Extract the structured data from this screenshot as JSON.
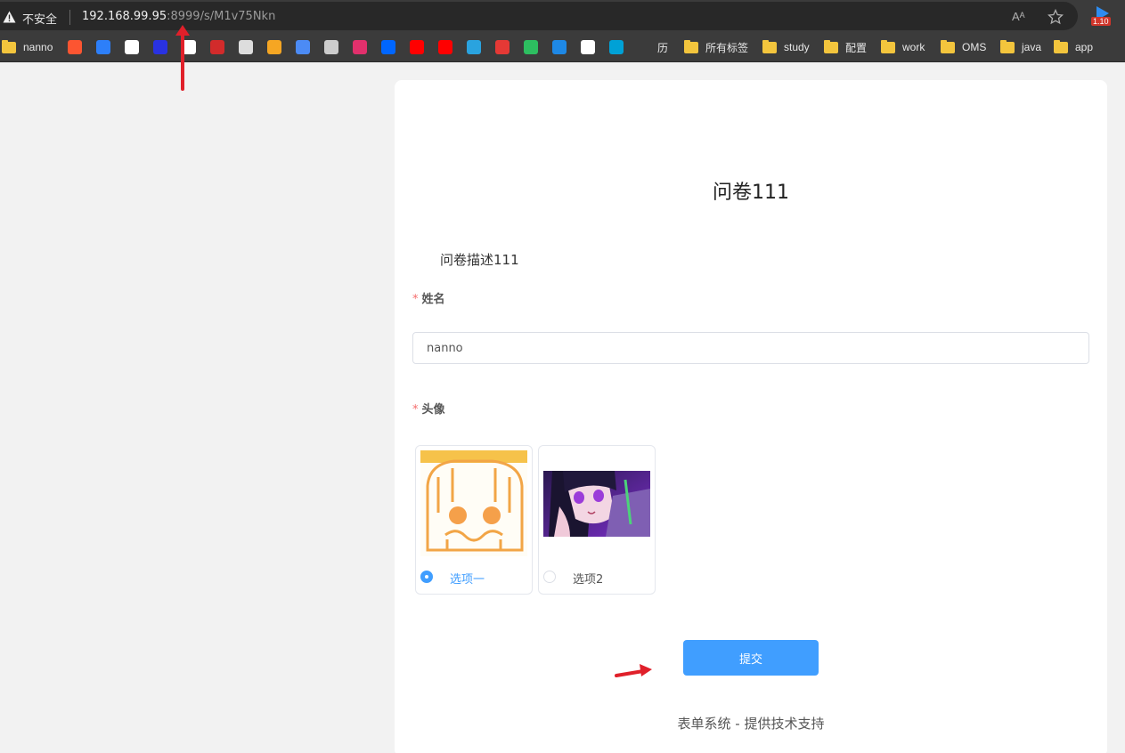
{
  "browser": {
    "insecure_label": "不安全",
    "url_host": "192.168.99.95",
    "url_path": ":8999/s/M1v75Nkn",
    "read_aloud_label": "Aᴬ",
    "extension_badge": "1.10",
    "bookmarks": [
      {
        "type": "folder",
        "label": "nanno"
      },
      {
        "type": "icon",
        "icon": "csdn-icon",
        "color": "#fc5531"
      },
      {
        "type": "icon",
        "icon": "layers-icon",
        "color": "#2d7ff9"
      },
      {
        "type": "icon",
        "icon": "brush-icon",
        "color": "#ffffff"
      },
      {
        "type": "icon",
        "icon": "baidu-icon",
        "color": "#2932e1"
      },
      {
        "type": "icon",
        "icon": "d-icon",
        "color": "#ffffff"
      },
      {
        "type": "icon",
        "icon": "seal-icon",
        "color": "#d22b2b"
      },
      {
        "type": "icon",
        "icon": "bird-icon",
        "color": "#dddddd"
      },
      {
        "type": "icon",
        "icon": "eye-icon",
        "color": "#f5a623"
      },
      {
        "type": "icon",
        "icon": "play-icon",
        "color": "#4c8bf5"
      },
      {
        "type": "icon",
        "icon": "github-icon",
        "color": "#cccccc"
      },
      {
        "type": "icon",
        "icon": "instagram-icon",
        "color": "#e1306c"
      },
      {
        "type": "icon",
        "icon": "zhihu-icon",
        "color": "#0066ff"
      },
      {
        "type": "icon",
        "icon": "youtube-icon",
        "color": "#ff0000"
      },
      {
        "type": "icon",
        "icon": "youtube-music-icon",
        "color": "#ff0000"
      },
      {
        "type": "icon",
        "icon": "telegram-icon",
        "color": "#2aa3df"
      },
      {
        "type": "icon",
        "icon": "g-icon",
        "color": "#e53935"
      },
      {
        "type": "icon",
        "icon": "evernote-icon",
        "color": "#2dbe60"
      },
      {
        "type": "icon",
        "icon": "bolt-icon",
        "color": "#1e88e5"
      },
      {
        "type": "icon",
        "icon": "codepen-icon",
        "color": "#ffffff"
      },
      {
        "type": "icon",
        "icon": "bilibili-icon",
        "color": "#00a1d6"
      },
      {
        "type": "icon-label",
        "icon": "bilibili-icon",
        "label": "历"
      },
      {
        "type": "folder",
        "label": "所有标签"
      },
      {
        "type": "folder",
        "label": "study"
      },
      {
        "type": "folder",
        "label": "配置"
      },
      {
        "type": "folder",
        "label": "work"
      },
      {
        "type": "folder",
        "label": "OMS"
      },
      {
        "type": "folder",
        "label": "java"
      },
      {
        "type": "folder",
        "label": "app"
      }
    ]
  },
  "form": {
    "title": "问卷111",
    "description": "问卷描述111",
    "name_field": {
      "label": "姓名",
      "required_mark": "*",
      "value": "nanno"
    },
    "avatar_field": {
      "label": "头像",
      "required_mark": "*"
    },
    "options": [
      {
        "label": "选项一",
        "checked": true
      },
      {
        "label": "选项2",
        "checked": false
      }
    ],
    "submit_label": "提交",
    "footer": "表单系统 - 提供技术支持"
  },
  "colors": {
    "primary": "#409eff",
    "required": "#f56c6c",
    "annotation_arrow": "#e0202a"
  }
}
